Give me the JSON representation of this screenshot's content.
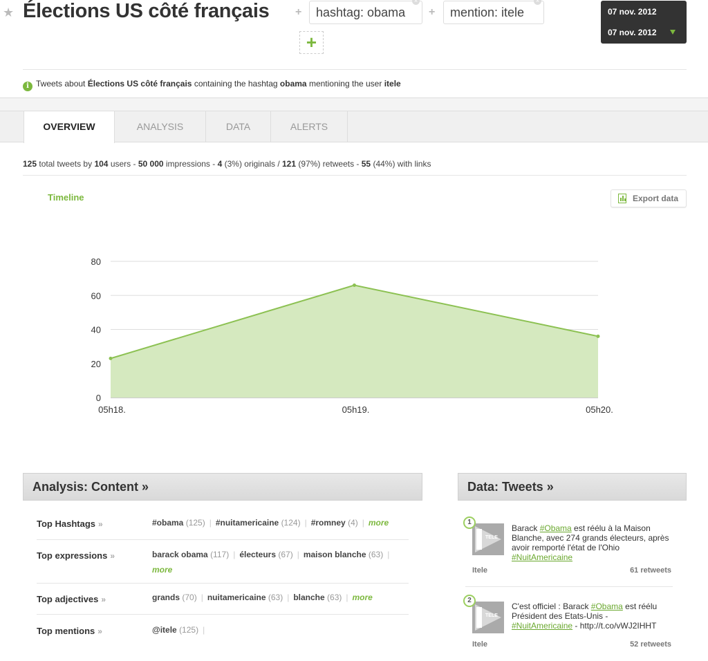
{
  "header": {
    "title": "Élections US côté français",
    "filters": [
      {
        "label": "hashtag: obama"
      },
      {
        "label": "mention: itele"
      }
    ],
    "date_range": {
      "start": "07 nov. 2012",
      "end": "07 nov. 2012"
    },
    "info": {
      "prefix": "Tweets about",
      "topic": "Élections US côté français",
      "middle": "containing the hashtag",
      "hashtag": "obama",
      "suffix": "mentioning the user",
      "user": "itele"
    }
  },
  "tabs": [
    {
      "label": "OVERVIEW",
      "active": true
    },
    {
      "label": "ANALYSIS",
      "active": false
    },
    {
      "label": "DATA",
      "active": false
    },
    {
      "label": "ALERTS",
      "active": false
    }
  ],
  "stats": {
    "total_tweets": "125",
    "t1": "total tweets by",
    "users": "104",
    "t2": "users -",
    "impressions": "50 000",
    "t3": "impressions -",
    "originals": "4",
    "t4": "(3%) originals /",
    "retweets": "121",
    "t5": "(97%) retweets -",
    "links": "55",
    "t6": "(44%) with links"
  },
  "timeline": {
    "title": "Timeline",
    "export_label": "Export data"
  },
  "chart_data": {
    "type": "area",
    "x": [
      "05h18.",
      "05h19.",
      "05h20."
    ],
    "series": [
      {
        "values": [
          23,
          66,
          36
        ]
      }
    ],
    "yticks": [
      0,
      20,
      40,
      60,
      80
    ],
    "ylim": [
      0,
      80
    ],
    "grid": true,
    "color": "#8cc152"
  },
  "analysis": {
    "title": "Analysis: Content »",
    "rows": [
      {
        "label": "Top Hashtags",
        "items": [
          {
            "text": "#obama",
            "count": "(125)"
          },
          {
            "text": "#nuitamericaine",
            "count": "(124)"
          },
          {
            "text": "#romney",
            "count": "(4)"
          }
        ],
        "more": "more"
      },
      {
        "label": "Top expressions",
        "items": [
          {
            "text": "barack obama",
            "count": "(117)"
          },
          {
            "text": "électeurs",
            "count": "(67)"
          },
          {
            "text": "maison blanche",
            "count": "(63)"
          }
        ],
        "more": "more"
      },
      {
        "label": "Top adjectives",
        "items": [
          {
            "text": "grands",
            "count": "(70)"
          },
          {
            "text": "nuitamericaine",
            "count": "(63)"
          },
          {
            "text": "blanche",
            "count": "(63)"
          }
        ],
        "more": "more"
      },
      {
        "label": "Top mentions",
        "items": [
          {
            "text": "@itele",
            "count": "(125)"
          }
        ],
        "more": ""
      }
    ]
  },
  "tweets_panel": {
    "title": "Data: Tweets »",
    "tweets": [
      {
        "rank": "1",
        "parts": [
          "Barack ",
          "#Obama",
          " est réélu à la Maison Blanche, avec 274 grands électeurs, après avoir remporté l'état de l'Ohio ",
          "#NuitAmericaine",
          ""
        ],
        "user": "Itele",
        "retweets": "61 retweets",
        "avatar_text": "TELE"
      },
      {
        "rank": "2",
        "parts": [
          "C'est officiel : Barack ",
          "#Obama",
          " est réélu Président des Etats-Unis - ",
          "#NuitAmericaine",
          " - http://t.co/vWJ2IHHT"
        ],
        "user": "Itele",
        "retweets": "52 retweets",
        "avatar_text": "TELE"
      }
    ]
  },
  "colors": {
    "accent": "#7cb83e",
    "dark": "#333333"
  }
}
